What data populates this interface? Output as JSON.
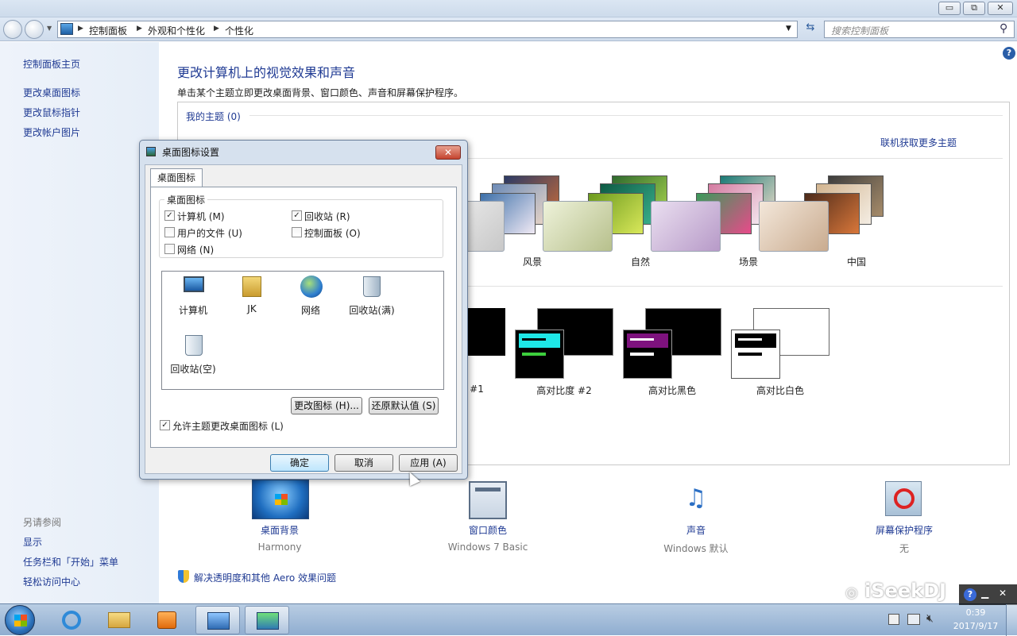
{
  "window": {
    "minimize": "▭",
    "maximize": "⧉",
    "close": "✕"
  },
  "navbar": {
    "breadcrumb": [
      "控制面板",
      "外观和个性化",
      "个性化"
    ],
    "search_placeholder": "搜索控制面板"
  },
  "sidebar": {
    "home": "控制面板主页",
    "links": [
      "更改桌面图标",
      "更改鼠标指针",
      "更改帐户图片"
    ],
    "see_also_title": "另请参阅",
    "see_also": [
      "显示",
      "任务栏和「开始」菜单",
      "轻松访问中心"
    ]
  },
  "main": {
    "title": "更改计算机上的视觉效果和声音",
    "subtitle": "单击某个主题立即更改桌面背景、窗口颜色、声音和屏幕保护程序。",
    "my_themes": "我的主题 (0)",
    "online_link": "联机获取更多主题",
    "aero_themes": [
      "风景",
      "自然",
      "场景",
      "中国"
    ],
    "basic_themes": [
      "#1",
      "高对比度 #2",
      "高对比黑色",
      "高对比白色"
    ],
    "bottom": [
      {
        "title": "桌面背景",
        "sub": "Harmony"
      },
      {
        "title": "窗口颜色",
        "sub": "Windows 7 Basic"
      },
      {
        "title": "声音",
        "sub": "Windows 默认"
      },
      {
        "title": "屏幕保护程序",
        "sub": "无"
      }
    ],
    "aero_troubleshoot": "解决透明度和其他 Aero 效果问题"
  },
  "dialog": {
    "title": "桌面图标设置",
    "tab": "桌面图标",
    "group": "桌面图标",
    "checkboxes": [
      {
        "label": "计算机 (M)",
        "checked": true
      },
      {
        "label": "回收站 (R)",
        "checked": true
      },
      {
        "label": "用户的文件 (U)",
        "checked": false
      },
      {
        "label": "控制面板 (O)",
        "checked": false
      },
      {
        "label": "网络 (N)",
        "checked": false
      }
    ],
    "icons": [
      "计算机",
      "JK",
      "网络",
      "回收站(满)",
      "回收站(空)"
    ],
    "change_icon": "更改图标 (H)...",
    "restore_default": "还原默认值 (S)",
    "allow_themes": "允许主题更改桌面图标 (L)",
    "allow_checked": true,
    "ok": "确定",
    "cancel": "取消",
    "apply": "应用 (A)"
  },
  "tray": {
    "time": "0:39",
    "date": "2017/9/17",
    "watermark": "iSeekDJ"
  }
}
